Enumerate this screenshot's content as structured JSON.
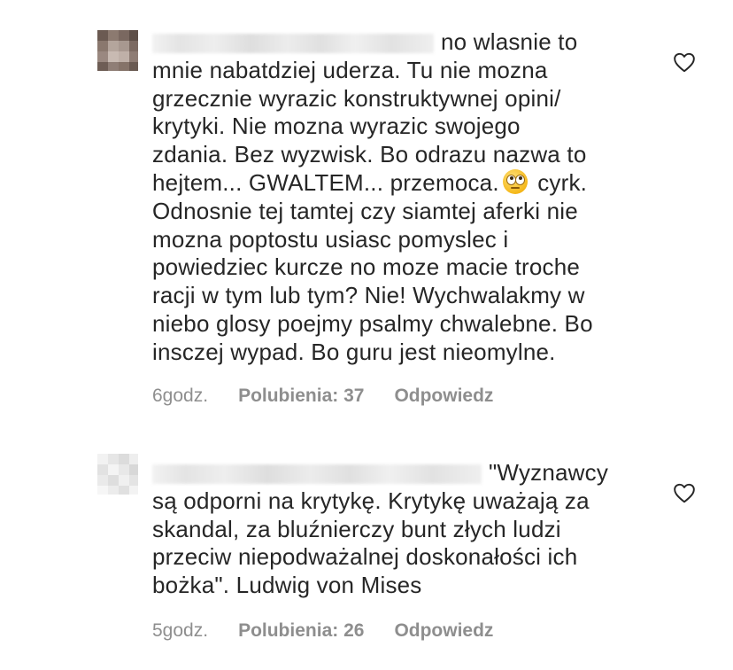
{
  "comments": [
    {
      "text_before_emoji": "no wlasnie to\nmnie nabatdziej uderza. Tu nie mozna\ngrzecznie wyrazic konstruktywnej opini/\nkrytyki. Nie mozna wyrazic swojego\nzdania. Bez wyzwisk. Bo odrazu nazwa to\nhejtem... GWALTEM... przemoca.",
      "emoji": "face-with-rolling-eyes",
      "text_after_emoji": " cyrk.\nOdnosnie tej tamtej czy siamtej aferki nie\nmozna poptostu usiasc pomyslec i\npowiedziec kurcze no moze macie troche\nracji w tym lub tym? Nie! Wychwalakmy w\nniebo glosy poejmy psalmy chwalebne. Bo\ninsczej wypad. Bo guru jest nieomylne.",
      "time": "6godz.",
      "likes": "Polubienia: 37",
      "reply": "Odpowiedz",
      "like_icon": "heart-outline-icon"
    },
    {
      "text": "\"Wyznawcy\nsą odporni na krytykę. Krytykę uważają za\nskandal, za bluźnierczy bunt złych ludzi\nprzeciw niepodważalnej doskonałości ich\nbożka\". Ludwig von Mises",
      "time": "5godz.",
      "likes": "Polubienia: 26",
      "reply": "Odpowiedz",
      "like_icon": "heart-outline-icon"
    }
  ],
  "colors": {
    "text": "#262626",
    "meta": "#8e8e8e",
    "background": "#ffffff"
  }
}
